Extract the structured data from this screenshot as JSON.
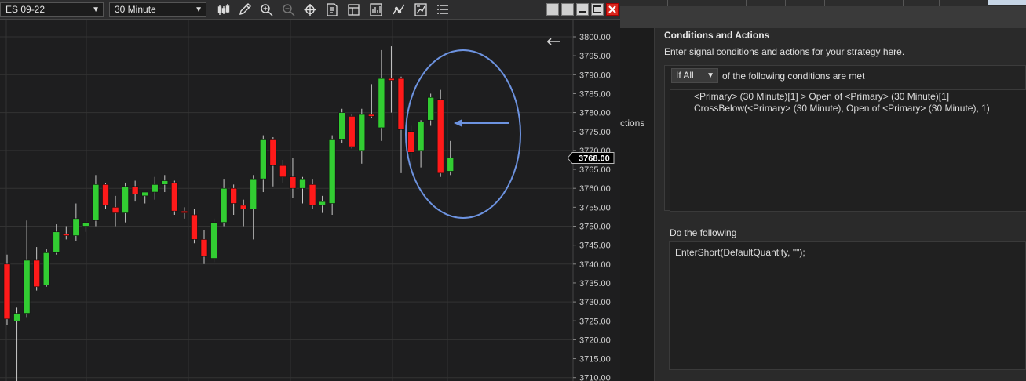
{
  "toolbar": {
    "instrument": "ES 09-22",
    "interval": "30 Minute",
    "icons": [
      "bar-style-icon",
      "pencil-icon",
      "zoom-in-icon",
      "zoom-out-icon",
      "crosshair-icon",
      "data-box-icon",
      "properties-icon",
      "performance-icon",
      "strategies-icon",
      "indicators-icon",
      "list-icon"
    ]
  },
  "window_buttons": [
    "tile-icon",
    "tile-icon",
    "minimize-icon",
    "maximize-icon",
    "close-icon"
  ],
  "colors": {
    "chart_bg": "#1e1e1f",
    "up": "#32cd32",
    "down": "#ff1a1a",
    "annotation": "#6d93e0",
    "grid": "#333333",
    "text": "#e0e0e0"
  },
  "chart_data": {
    "type": "candlestick",
    "symbol": "ES 09-22",
    "interval": "30 Minute",
    "ylim": [
      3708,
      3803
    ],
    "yticks": [
      "3800.00",
      "3795.00",
      "3790.00",
      "3785.00",
      "3780.00",
      "3775.00",
      "3770.00",
      "3765.00",
      "3760.00",
      "3755.00",
      "3750.00",
      "3745.00",
      "3740.00",
      "3735.00",
      "3730.00",
      "3725.00",
      "3720.00",
      "3715.00",
      "3710.00"
    ],
    "last_price_label": "3768.00",
    "last_price": 3768,
    "back_arrow": "←",
    "candles": [
      {
        "o": 3740.0,
        "h": 3742.5,
        "l": 3724.0,
        "c": 3725.5
      },
      {
        "o": 3725.0,
        "h": 3728.5,
        "l": 3705.0,
        "c": 3727.0
      },
      {
        "o": 3727.0,
        "h": 3751.5,
        "l": 3726.0,
        "c": 3741.0
      },
      {
        "o": 3741.0,
        "h": 3744.5,
        "l": 3733.0,
        "c": 3734.0
      },
      {
        "o": 3734.5,
        "h": 3744.0,
        "l": 3734.0,
        "c": 3743.0
      },
      {
        "o": 3743.0,
        "h": 3750.5,
        "l": 3742.5,
        "c": 3748.5
      },
      {
        "o": 3748.0,
        "h": 3750.0,
        "l": 3746.5,
        "c": 3747.5
      },
      {
        "o": 3747.5,
        "h": 3756.0,
        "l": 3746.0,
        "c": 3752.0
      },
      {
        "o": 3750.0,
        "h": 3751.0,
        "l": 3748.5,
        "c": 3751.0
      },
      {
        "o": 3751.5,
        "h": 3763.5,
        "l": 3750.0,
        "c": 3761.0
      },
      {
        "o": 3761.0,
        "h": 3761.5,
        "l": 3754.5,
        "c": 3755.5
      },
      {
        "o": 3755.0,
        "h": 3758.0,
        "l": 3750.0,
        "c": 3753.5
      },
      {
        "o": 3753.5,
        "h": 3761.5,
        "l": 3751.0,
        "c": 3760.5
      },
      {
        "o": 3760.5,
        "h": 3762.0,
        "l": 3756.5,
        "c": 3758.5
      },
      {
        "o": 3758.0,
        "h": 3759.0,
        "l": 3756.0,
        "c": 3759.0
      },
      {
        "o": 3759.0,
        "h": 3763.0,
        "l": 3757.0,
        "c": 3761.0
      },
      {
        "o": 3761.0,
        "h": 3763.5,
        "l": 3759.0,
        "c": 3762.0
      },
      {
        "o": 3761.5,
        "h": 3762.0,
        "l": 3753.0,
        "c": 3754.0
      },
      {
        "o": 3754.0,
        "h": 3755.0,
        "l": 3752.0,
        "c": 3753.5
      },
      {
        "o": 3753.0,
        "h": 3754.5,
        "l": 3745.5,
        "c": 3746.5
      },
      {
        "o": 3746.5,
        "h": 3749.0,
        "l": 3740.0,
        "c": 3742.0
      },
      {
        "o": 3741.5,
        "h": 3752.0,
        "l": 3740.5,
        "c": 3751.0
      },
      {
        "o": 3751.0,
        "h": 3762.5,
        "l": 3750.0,
        "c": 3760.0
      },
      {
        "o": 3760.0,
        "h": 3761.0,
        "l": 3753.0,
        "c": 3756.0
      },
      {
        "o": 3755.5,
        "h": 3757.0,
        "l": 3750.0,
        "c": 3754.5
      },
      {
        "o": 3754.5,
        "h": 3763.5,
        "l": 3746.5,
        "c": 3762.5
      },
      {
        "o": 3762.5,
        "h": 3774.0,
        "l": 3759.0,
        "c": 3773.0
      },
      {
        "o": 3773.0,
        "h": 3773.5,
        "l": 3760.5,
        "c": 3766.0
      },
      {
        "o": 3766.0,
        "h": 3767.5,
        "l": 3761.5,
        "c": 3763.0
      },
      {
        "o": 3763.0,
        "h": 3768.0,
        "l": 3757.5,
        "c": 3760.0
      },
      {
        "o": 3760.0,
        "h": 3763.0,
        "l": 3756.0,
        "c": 3762.5
      },
      {
        "o": 3761.0,
        "h": 3762.5,
        "l": 3754.5,
        "c": 3755.5
      },
      {
        "o": 3755.5,
        "h": 3758.0,
        "l": 3753.5,
        "c": 3756.5
      },
      {
        "o": 3756.0,
        "h": 3774.0,
        "l": 3753.0,
        "c": 3773.0
      },
      {
        "o": 3773.0,
        "h": 3781.0,
        "l": 3772.0,
        "c": 3780.0
      },
      {
        "o": 3779.0,
        "h": 3779.5,
        "l": 3770.5,
        "c": 3771.0
      },
      {
        "o": 3770.0,
        "h": 3781.0,
        "l": 3766.5,
        "c": 3779.5
      },
      {
        "o": 3779.5,
        "h": 3787.5,
        "l": 3778.5,
        "c": 3779.0
      },
      {
        "o": 3776.0,
        "h": 3796.5,
        "l": 3772.5,
        "c": 3789.0
      },
      {
        "o": 3789.0,
        "h": 3797.5,
        "l": 3780.0,
        "c": 3788.5
      },
      {
        "o": 3789.0,
        "h": 3789.5,
        "l": 3764.0,
        "c": 3775.5
      },
      {
        "o": 3775.0,
        "h": 3776.5,
        "l": 3764.5,
        "c": 3769.5
      },
      {
        "o": 3770.0,
        "h": 3778.0,
        "l": 3765.5,
        "c": 3777.5
      },
      {
        "o": 3778.0,
        "h": 3785.0,
        "l": 3776.5,
        "c": 3784.0
      },
      {
        "o": 3783.5,
        "h": 3786.0,
        "l": 3763.0,
        "c": 3764.0
      },
      {
        "o": 3764.5,
        "h": 3772.5,
        "l": 3763.5,
        "c": 3768.0
      }
    ]
  },
  "partial_label": "ctions",
  "wizard": {
    "title": "Conditions and Actions",
    "subtitle": "Enter signal conditions and actions for your strategy here.",
    "mode": "If All",
    "mode_suffix": "of the following conditions are met",
    "conditions": [
      "<Primary> (30 Minute)[1] > Open of <Primary> (30 Minute)[1]",
      "CrossBelow(<Primary> (30 Minute), Open of <Primary> (30 Minute), 1)"
    ],
    "actions_label": "Do the following",
    "actions": [
      "EnterShort(DefaultQuantity, \"\");"
    ]
  }
}
